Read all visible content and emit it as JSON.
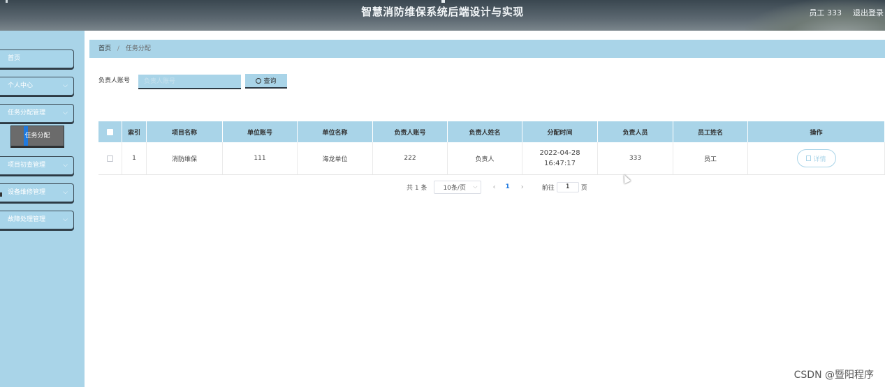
{
  "header": {
    "title": "智慧消防维保系统后端设计与实现",
    "user": "员工 333",
    "logout": "退出登录"
  },
  "sidebar": {
    "items": [
      {
        "label": "首页",
        "has_arrow": false
      },
      {
        "label": "个人中心",
        "has_arrow": true
      },
      {
        "label": "任务分配管理",
        "has_arrow": true
      },
      {
        "label": "项目初查管理",
        "has_arrow": true
      },
      {
        "label": "设备维修管理",
        "has_arrow": true
      },
      {
        "label": "故障处理管理",
        "has_arrow": true
      }
    ],
    "active_sub": "任务分配",
    "arrow": "⌵"
  },
  "breadcrumb": {
    "home": "首页",
    "separator": "/",
    "current": "任务分配"
  },
  "search": {
    "label": "负责人账号",
    "placeholder": "负责人账号",
    "value": "",
    "button": "查询"
  },
  "table": {
    "columns": [
      "索引",
      "项目名称",
      "单位账号",
      "单位名称",
      "负责人账号",
      "负责人姓名",
      "分配时间",
      "负责人员",
      "员工姓名",
      "操作"
    ],
    "rows": [
      {
        "index": "1",
        "project": "消防维保",
        "unit_account": "111",
        "unit_name": "海龙单位",
        "leader_account": "222",
        "leader_name": "负责人",
        "assign_time": "2022-04-28 16:47:17",
        "staff_account": "333",
        "staff_name": "员工",
        "action": "详情"
      }
    ]
  },
  "pagination": {
    "total": "共 1 条",
    "page_size": "10条/页",
    "prev": "‹",
    "current_page": "1",
    "next": "›",
    "goto_label": "前往",
    "goto_value": "1",
    "goto_suffix": "页"
  },
  "watermark": "CSDN @暨阳程序"
}
